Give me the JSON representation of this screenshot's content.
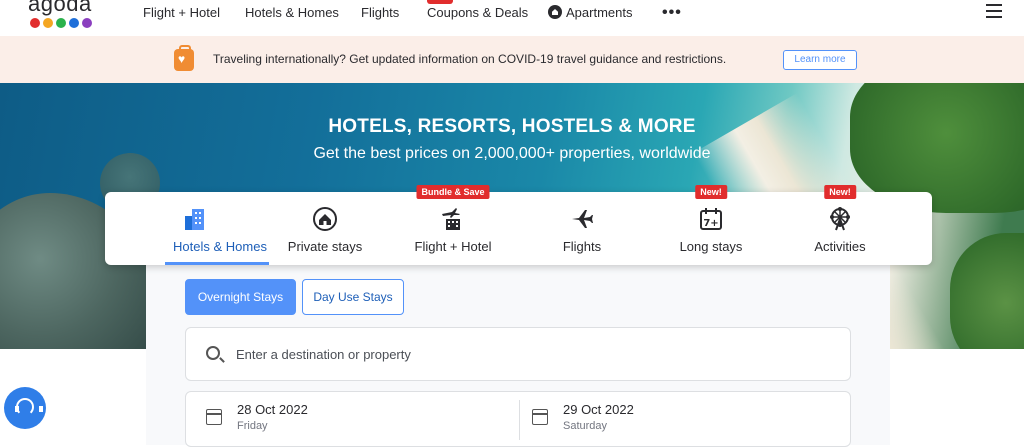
{
  "logo": {
    "text": "agoda",
    "dots": [
      "#e12d2d",
      "#f4a622",
      "#2bb24c",
      "#1e6fd9",
      "#8b3fbf"
    ]
  },
  "nav": {
    "items": [
      {
        "label": "Flight + Hotel"
      },
      {
        "label": "Hotels & Homes"
      },
      {
        "label": "Flights"
      },
      {
        "label": "Coupons & Deals"
      },
      {
        "label": "Apartments",
        "icon": "apartment-icon"
      }
    ],
    "more_label": "•••",
    "menu_icon": "hamburger-icon"
  },
  "banner": {
    "icon": "travel-suitcase-icon",
    "text": "Traveling internationally? Get updated information on COVID-19 travel guidance and restrictions.",
    "button_label": "Learn more"
  },
  "hero": {
    "title": "HOTELS, RESORTS, HOSTELS & MORE",
    "subtitle": "Get the best prices on 2,000,000+ properties, worldwide"
  },
  "product_tabs": [
    {
      "label": "Hotels & Homes",
      "icon": "hotel-building-icon",
      "active": true,
      "badge": ""
    },
    {
      "label": "Private stays",
      "icon": "home-icon",
      "active": false,
      "badge": ""
    },
    {
      "label": "Flight + Hotel",
      "icon": "flight-hotel-icon",
      "active": false,
      "badge": "Bundle & Save"
    },
    {
      "label": "Flights",
      "icon": "airplane-icon",
      "active": false,
      "badge": ""
    },
    {
      "label": "Long stays",
      "icon": "calendar-7-icon",
      "active": false,
      "badge": "New!"
    },
    {
      "label": "Activities",
      "icon": "ferris-wheel-icon",
      "active": false,
      "badge": "New!"
    }
  ],
  "stay_type": {
    "options": [
      "Overnight Stays",
      "Day Use Stays"
    ],
    "selected": "Overnight Stays"
  },
  "search": {
    "placeholder": "Enter a destination or property"
  },
  "dates": {
    "check_in": {
      "date": "28 Oct 2022",
      "day": "Friday"
    },
    "check_out": {
      "date": "29 Oct 2022",
      "day": "Saturday"
    }
  },
  "colors": {
    "accent": "#5392f9",
    "badge": "#e12d2d",
    "banner_bg": "#fbeee8"
  }
}
